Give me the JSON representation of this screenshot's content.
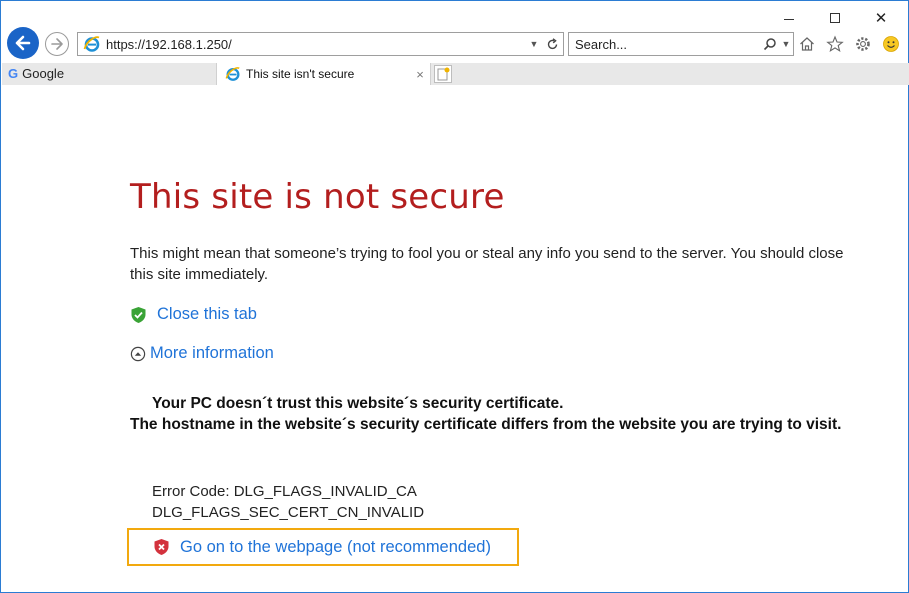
{
  "browser": {
    "address": "https://192.168.1.250/",
    "search_placeholder": "Search...",
    "favorites": [
      {
        "label": "Google"
      }
    ],
    "tab": {
      "title": "This site isn't secure",
      "close": "×"
    },
    "window_controls": {
      "close": "✕"
    }
  },
  "page": {
    "title": "This site is not secure",
    "description": "This might mean that someone’s trying to fool you or steal any info you send to the server. You should close this site immediately.",
    "close_tab": "Close this tab",
    "more_info": "More information",
    "message_line1": "Your PC doesn´t trust this website´s security certificate.",
    "message_line2": "The hostname in the website´s security certificate differs from the website you are trying to visit.",
    "error_code": "Error Code: DLG_FLAGS_INVALID_CA",
    "error_code2": "DLG_FLAGS_SEC_CERT_CN_INVALID",
    "go_on": "Go on to the webpage (not recommended)"
  },
  "colors": {
    "title": "#b31e1e",
    "link": "#1f73d8",
    "focus_border": "#f2a90e",
    "back_button": "#1a64c7",
    "frame_border": "#2b7cd3"
  },
  "icons": [
    "back-arrow-icon",
    "forward-arrow-icon",
    "ie-icon",
    "refresh-icon",
    "search-icon",
    "home-icon",
    "favorites-star-icon",
    "settings-gear-icon",
    "smiley-icon",
    "green-shield-icon",
    "expand-circle-icon",
    "red-shield-icon"
  ]
}
